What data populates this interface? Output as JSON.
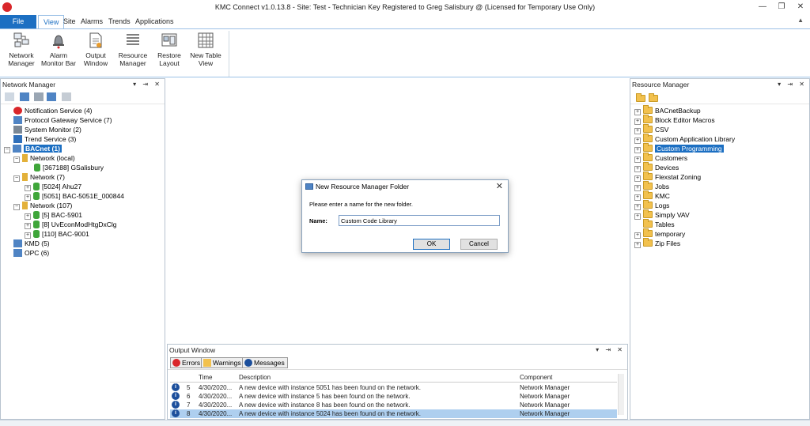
{
  "window": {
    "title": "KMC Connect  v1.0.13.8  - Site: Test - Technician Key Registered to Greg Salisbury @  (Licensed for Temporary Use Only)",
    "minimize": "—",
    "restore": "❐",
    "close": "✕"
  },
  "menu": {
    "tabs": [
      "File",
      "View",
      "Site",
      "Alarms",
      "Trends",
      "Applications"
    ],
    "active": "View"
  },
  "ribbon": {
    "buttons": [
      {
        "label1": "Network",
        "label2": "Manager",
        "icon": "network-manager-icon"
      },
      {
        "label1": "Alarm",
        "label2": "Monitor Bar",
        "icon": "alarm-bell-icon"
      },
      {
        "label1": "Output",
        "label2": "Window",
        "icon": "output-window-icon"
      },
      {
        "label1": "Resource",
        "label2": "Manager",
        "icon": "resource-list-icon"
      },
      {
        "label1": "Restore",
        "label2": "Layout",
        "icon": "restore-layout-icon"
      },
      {
        "label1": "New Table",
        "label2": "View",
        "icon": "table-grid-icon"
      }
    ]
  },
  "network_manager": {
    "title": "Network Manager",
    "tree": [
      "Notification Service (4)",
      "Protocol Gateway Service (7)",
      "System Monitor (2)",
      "Trend Service (3)",
      "BACnet (1)",
      "Network (local)",
      "[367188] GSalisbury",
      "Network (7)",
      "[5024] Ahu27",
      "[5051] BAC-5051E_000844",
      "Network (107)",
      "[5] BAC-5901",
      "[8] UvEconModHtgDxClg",
      "[110] BAC-9001",
      "KMD (5)",
      "OPC (6)"
    ]
  },
  "resource_manager": {
    "title": "Resource Manager",
    "folders": [
      "BACnetBackup",
      "Block Editor Macros",
      "CSV",
      "Custom Application Library",
      "Custom Programming",
      "Customers",
      "Devices",
      "Flexstat Zoning",
      "Jobs",
      "KMC",
      "Logs",
      "Simply VAV",
      "Tables",
      "temporary",
      "Zip Files"
    ],
    "selected": "Custom Programming"
  },
  "output_window": {
    "title": "Output Window",
    "tabs": [
      "Errors",
      "Warnings",
      "Messages"
    ],
    "columns": [
      "Time",
      "Description",
      "Component"
    ],
    "rows": [
      {
        "num": "5",
        "time": "4/30/2020...",
        "desc": "A new device with instance 5051 has been found on the network.",
        "comp": "Network Manager"
      },
      {
        "num": "6",
        "time": "4/30/2020...",
        "desc": "A new device with instance 5 has been found on the network.",
        "comp": "Network Manager"
      },
      {
        "num": "7",
        "time": "4/30/2020...",
        "desc": "A new device with instance 8 has been found on the network.",
        "comp": "Network Manager"
      },
      {
        "num": "8",
        "time": "4/30/2020...",
        "desc": "A new device with instance 5024 has been found on the network.",
        "comp": "Network Manager"
      }
    ]
  },
  "dialog": {
    "title": "New Resource Manager Folder",
    "prompt": "Please enter a name for the new folder.",
    "name_label": "Name:",
    "name_value": "Custom Code Library",
    "ok": "OK",
    "cancel": "Cancel",
    "close": "✕"
  }
}
